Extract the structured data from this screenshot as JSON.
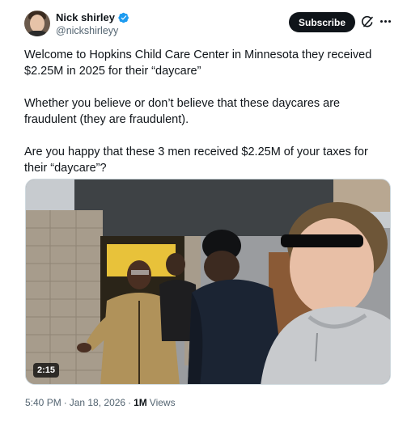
{
  "author": {
    "display_name": "Nick shirley",
    "handle": "@nickshirleyy",
    "verified": true,
    "avatar_icon": "avatar-photo"
  },
  "actions": {
    "subscribe_label": "Subscribe",
    "grok_icon": "grok-icon",
    "more_icon": "more-icon"
  },
  "tweet": {
    "paragraphs": [
      "Welcome to Hopkins Child Care Center in Minnesota they received $2.25M in 2025 for their “daycare”",
      "Whether you believe or don’t believe that these daycares are fraudulent (they are fraudulent).",
      "Are you happy that these 3 men received $2.25M of your taxes for their “daycare”?"
    ]
  },
  "media": {
    "type": "video",
    "duration": "2:15"
  },
  "meta": {
    "time": "5:40 PM",
    "separator": "·",
    "date": "Jan 18, 2026",
    "views_count": "1M",
    "views_label": "Views"
  },
  "colors": {
    "text": "#0f1419",
    "secondary": "#536471",
    "verified": "#1d9bf0",
    "button_bg": "#0f1419"
  }
}
